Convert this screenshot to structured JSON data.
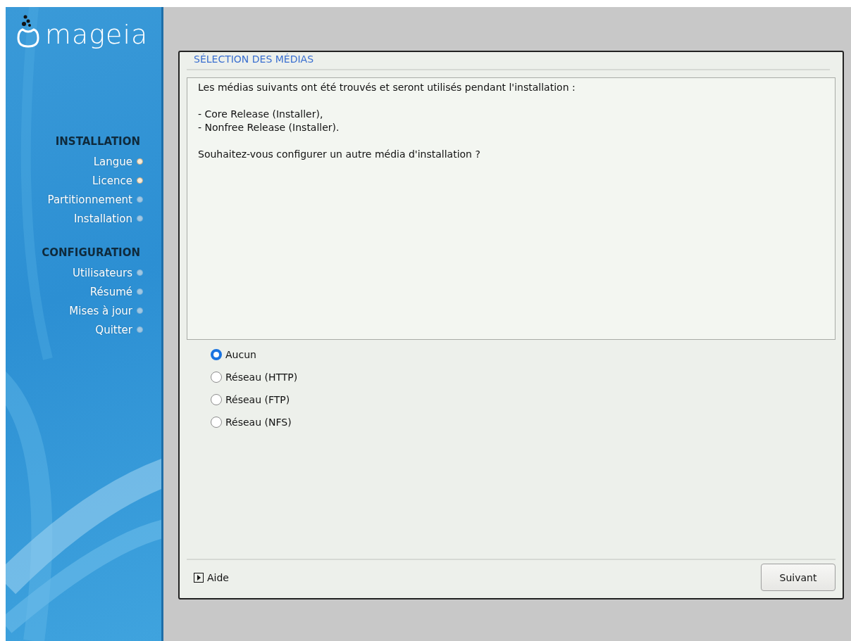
{
  "sidebar": {
    "logo_text": "mageia",
    "sections": [
      {
        "title": "INSTALLATION",
        "steps": [
          {
            "label": "Langue",
            "done": true
          },
          {
            "label": "Licence",
            "done": true
          },
          {
            "label": "Partitionnement",
            "done": false
          },
          {
            "label": "Installation",
            "done": false
          }
        ]
      },
      {
        "title": "CONFIGURATION",
        "steps": [
          {
            "label": "Utilisateurs",
            "done": false
          },
          {
            "label": "Résumé",
            "done": false
          },
          {
            "label": "Mises à jour",
            "done": false
          },
          {
            "label": "Quitter",
            "done": false
          }
        ]
      }
    ]
  },
  "dialog": {
    "title": "SÉLECTION DES MÉDIAS",
    "message": [
      [
        "Les médias suivants ont été trouvés et seront utilisés pendant l'installation :"
      ],
      [
        "- Core Release (Installer),",
        "- Nonfree Release (Installer)."
      ],
      [
        "Souhaitez-vous configurer un autre média d'installation ?"
      ]
    ],
    "options": [
      {
        "label": "Aucun",
        "selected": true
      },
      {
        "label": "Réseau (HTTP)",
        "selected": false
      },
      {
        "label": "Réseau (FTP)",
        "selected": false
      },
      {
        "label": "Réseau (NFS)",
        "selected": false
      }
    ],
    "help": {
      "label": "Aide",
      "expanded": false
    },
    "buttons": [
      "Suivant"
    ]
  }
}
